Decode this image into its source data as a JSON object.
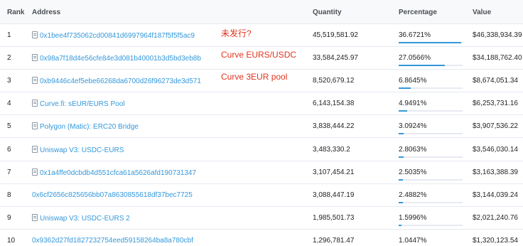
{
  "header": {
    "rank": "Rank",
    "address": "Address",
    "quantity": "Quantity",
    "percentage": "Percentage",
    "value": "Value"
  },
  "rows": [
    {
      "rank": "1",
      "address": "0x1bee4f735062cd00841d6997964f187f5f5f5ac9",
      "doc": true,
      "quantity": "45,519,581.92",
      "percentage": "36.6721%",
      "pct": 36.6721,
      "value": "$46,338,934.39"
    },
    {
      "rank": "2",
      "address": "0x98a7f18d4e56cfe84e3d081b40001b3d5bd3eb8b",
      "doc": true,
      "quantity": "33,584,245.97",
      "percentage": "27.0566%",
      "pct": 27.0566,
      "value": "$34,188,762.40"
    },
    {
      "rank": "3",
      "address": "0xb9446c4ef5ebe66268da6700d26f96273de3d571",
      "doc": true,
      "quantity": "8,520,679.12",
      "percentage": "6.8645%",
      "pct": 6.8645,
      "value": "$8,674,051.34"
    },
    {
      "rank": "4",
      "address": "Curve.fi: sEUR/EURS Pool",
      "doc": true,
      "quantity": "6,143,154.38",
      "percentage": "4.9491%",
      "pct": 4.9491,
      "value": "$6,253,731.16"
    },
    {
      "rank": "5",
      "address": "Polygon (Matic): ERC20 Bridge",
      "doc": true,
      "quantity": "3,838,444.22",
      "percentage": "3.0924%",
      "pct": 3.0924,
      "value": "$3,907,536.22"
    },
    {
      "rank": "6",
      "address": "Uniswap V3: USDC-EURS",
      "doc": true,
      "quantity": "3,483,330.2",
      "percentage": "2.8063%",
      "pct": 2.8063,
      "value": "$3,546,030.14"
    },
    {
      "rank": "7",
      "address": "0x1a4ffe0dcbdb4d551cfca61a5626afd190731347",
      "doc": true,
      "quantity": "3,107,454.21",
      "percentage": "2.5035%",
      "pct": 2.5035,
      "value": "$3,163,388.39"
    },
    {
      "rank": "8",
      "address": "0x6cf2656c825656bb07a8630855618df37bec7725",
      "doc": false,
      "quantity": "3,088,447.19",
      "percentage": "2.4882%",
      "pct": 2.4882,
      "value": "$3,144,039.24"
    },
    {
      "rank": "9",
      "address": "Uniswap V3: USDC-EURS 2",
      "doc": true,
      "quantity": "1,985,501.73",
      "percentage": "1.5996%",
      "pct": 1.5996,
      "value": "$2,021,240.76"
    },
    {
      "rank": "10",
      "address": "0x9362d27fd1827232754eed59158264ba8a780cbf",
      "doc": false,
      "quantity": "1,296,781.47",
      "percentage": "1.0447%",
      "pct": 1.0447,
      "value": "$1,320,123.54"
    }
  ],
  "notes": {
    "row1": "未发行?",
    "row2": "Curve EURS/USDC",
    "row3": "Curve 3EUR pool"
  },
  "colors": {
    "link": "#3498db",
    "annotation": "#e0341f",
    "bar": "#3498db"
  }
}
